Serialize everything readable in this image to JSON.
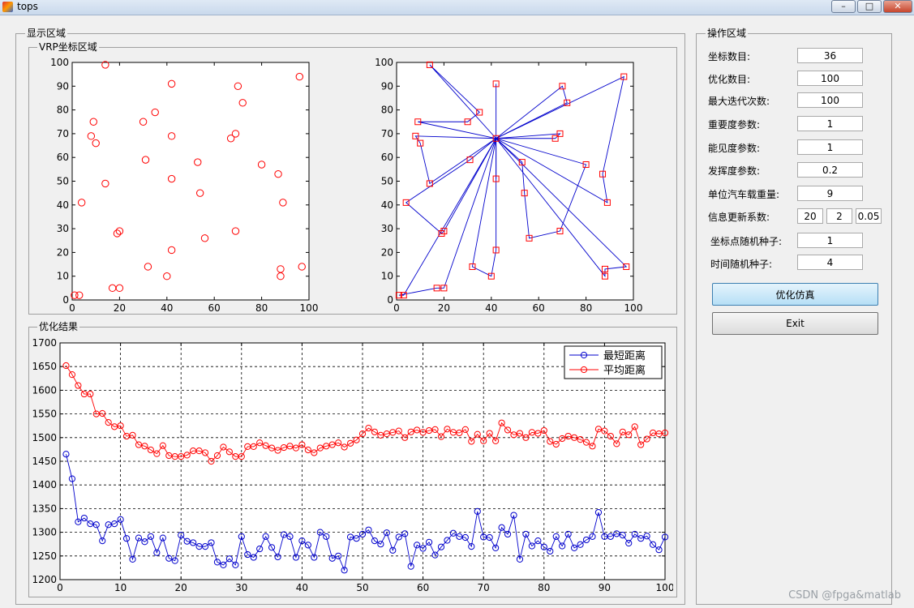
{
  "window": {
    "title": "tops",
    "min_label": "–",
    "max_label": "□",
    "close_label": "✕"
  },
  "display_area": {
    "title": "显示区域",
    "vrp_panel_title": "VRP坐标区域",
    "result_panel_title": "优化结果"
  },
  "operation_area": {
    "title": "操作区域",
    "fields": [
      {
        "label": "坐标数目:",
        "value": "36"
      },
      {
        "label": "优化数目:",
        "value": "100"
      },
      {
        "label": "最大迭代次数:",
        "value": "100"
      },
      {
        "label": "重要度参数:",
        "value": "1"
      },
      {
        "label": "能见度参数:",
        "value": "1"
      },
      {
        "label": "发挥度参数:",
        "value": "0.2"
      },
      {
        "label": "单位汽车载重量:",
        "value": "9"
      }
    ],
    "update_coeff": {
      "label": "信息更新系数:",
      "values": [
        "20",
        "2",
        "0.05"
      ]
    },
    "coord_seed": {
      "label": "坐标点随机种子:",
      "value": "1"
    },
    "time_seed": {
      "label": "时间随机种子:",
      "value": "4"
    },
    "simulate_button": "优化仿真",
    "exit_button": "Exit"
  },
  "watermark": "CSDN @fpga&matlab",
  "colors": {
    "red": "#ff0000",
    "blue": "#0000cc",
    "panel_bg": "#f0f0f0"
  },
  "chart_data": [
    {
      "type": "scatter",
      "title": "",
      "xlim": [
        0,
        100
      ],
      "ylim": [
        0,
        100
      ],
      "xticks": [
        "0",
        "20",
        "40",
        "60",
        "80",
        "100"
      ],
      "yticks": [
        "0",
        "10",
        "20",
        "30",
        "40",
        "50",
        "60",
        "70",
        "80",
        "90",
        "100"
      ],
      "marker": "circle",
      "color": "red",
      "points": [
        [
          1,
          2
        ],
        [
          3,
          2
        ],
        [
          4,
          41
        ],
        [
          8,
          69
        ],
        [
          9,
          75
        ],
        [
          10,
          66
        ],
        [
          14,
          49
        ],
        [
          14,
          99
        ],
        [
          17,
          5
        ],
        [
          19,
          28
        ],
        [
          20,
          5
        ],
        [
          20,
          29
        ],
        [
          30,
          75
        ],
        [
          31,
          59
        ],
        [
          32,
          14
        ],
        [
          35,
          79
        ],
        [
          40,
          10
        ],
        [
          42,
          69
        ],
        [
          42,
          91
        ],
        [
          42,
          51
        ],
        [
          42,
          21
        ],
        [
          53,
          58
        ],
        [
          54,
          45
        ],
        [
          56,
          26
        ],
        [
          67,
          68
        ],
        [
          69,
          29
        ],
        [
          69,
          70
        ],
        [
          70,
          90
        ],
        [
          72,
          83
        ],
        [
          80,
          57
        ],
        [
          87,
          53
        ],
        [
          88,
          10
        ],
        [
          88,
          13
        ],
        [
          89,
          41
        ],
        [
          96,
          94
        ],
        [
          97,
          14
        ]
      ]
    },
    {
      "type": "line",
      "title": "",
      "xlim": [
        0,
        100
      ],
      "ylim": [
        0,
        100
      ],
      "xticks": [
        "0",
        "20",
        "40",
        "60",
        "80",
        "100"
      ],
      "yticks": [
        "0",
        "10",
        "20",
        "30",
        "40",
        "50",
        "60",
        "70",
        "80",
        "90",
        "100"
      ],
      "marker": "square",
      "marker_color": "red",
      "line_color": "blue",
      "depot": [
        42,
        68
      ],
      "routes": [
        [
          [
            42,
            68
          ],
          [
            14,
            99
          ],
          [
            35,
            79
          ],
          [
            30,
            75
          ],
          [
            9,
            75
          ],
          [
            42,
            68
          ]
        ],
        [
          [
            42,
            68
          ],
          [
            8,
            69
          ],
          [
            10,
            66
          ],
          [
            14,
            49
          ],
          [
            42,
            68
          ]
        ],
        [
          [
            42,
            68
          ],
          [
            42,
            91
          ],
          [
            42,
            68
          ]
        ],
        [
          [
            42,
            68
          ],
          [
            70,
            90
          ],
          [
            72,
            83
          ],
          [
            42,
            68
          ]
        ],
        [
          [
            42,
            68
          ],
          [
            67,
            68
          ],
          [
            69,
            70
          ],
          [
            42,
            68
          ]
        ],
        [
          [
            42,
            68
          ],
          [
            96,
            94
          ],
          [
            87,
            53
          ],
          [
            89,
            41
          ],
          [
            42,
            68
          ]
        ],
        [
          [
            42,
            68
          ],
          [
            80,
            57
          ],
          [
            69,
            29
          ],
          [
            56,
            26
          ],
          [
            54,
            45
          ],
          [
            53,
            58
          ],
          [
            42,
            68
          ]
        ],
        [
          [
            42,
            68
          ],
          [
            97,
            14
          ],
          [
            88,
            13
          ],
          [
            88,
            10
          ],
          [
            42,
            68
          ]
        ],
        [
          [
            42,
            68
          ],
          [
            42,
            51
          ],
          [
            42,
            68
          ]
        ],
        [
          [
            42,
            68
          ],
          [
            42,
            21
          ],
          [
            40,
            10
          ],
          [
            32,
            14
          ],
          [
            42,
            68
          ]
        ],
        [
          [
            42,
            68
          ],
          [
            31,
            59
          ],
          [
            4,
            41
          ],
          [
            19,
            28
          ],
          [
            20,
            29
          ],
          [
            42,
            68
          ]
        ],
        [
          [
            42,
            68
          ],
          [
            3,
            2
          ],
          [
            1,
            2
          ],
          [
            17,
            5
          ],
          [
            20,
            5
          ],
          [
            42,
            68
          ]
        ]
      ]
    },
    {
      "type": "line",
      "title": "",
      "xlim": [
        0,
        100
      ],
      "ylim": [
        1200,
        1700
      ],
      "xticks": [
        "0",
        "10",
        "20",
        "30",
        "40",
        "50",
        "60",
        "70",
        "80",
        "90",
        "100"
      ],
      "yticks": [
        "1200",
        "1250",
        "1300",
        "1350",
        "1400",
        "1450",
        "1500",
        "1550",
        "1600",
        "1650",
        "1700"
      ],
      "grid": true,
      "legend_position": "top-right",
      "series": [
        {
          "name": "最短距离",
          "color": "blue",
          "values": [
            1465,
            1413,
            1322,
            1330,
            1318,
            1316,
            1282,
            1316,
            1318,
            1327,
            1287,
            1243,
            1288,
            1280,
            1291,
            1257,
            1288,
            1245,
            1240,
            1294,
            1281,
            1278,
            1270,
            1270,
            1278,
            1237,
            1231,
            1244,
            1231,
            1291,
            1253,
            1247,
            1265,
            1291,
            1268,
            1248,
            1295,
            1291,
            1247,
            1282,
            1273,
            1247,
            1300,
            1291,
            1245,
            1250,
            1220,
            1290,
            1287,
            1296,
            1305,
            1282,
            1275,
            1299,
            1262,
            1290,
            1297,
            1228,
            1273,
            1266,
            1279,
            1252,
            1269,
            1283,
            1298,
            1291,
            1289,
            1270,
            1344,
            1290,
            1289,
            1267,
            1310,
            1296,
            1336,
            1243,
            1296,
            1271,
            1282,
            1269,
            1260,
            1291,
            1271,
            1296,
            1267,
            1274,
            1284,
            1291,
            1342,
            1291,
            1291,
            1297,
            1294,
            1277,
            1296,
            1287,
            1292,
            1274,
            1263,
            1290
          ]
        },
        {
          "name": "平均距离",
          "color": "red",
          "values": [
            1652,
            1633,
            1610,
            1592,
            1592,
            1550,
            1551,
            1532,
            1523,
            1525,
            1503,
            1505,
            1485,
            1482,
            1474,
            1466,
            1483,
            1462,
            1460,
            1460,
            1463,
            1472,
            1472,
            1468,
            1450,
            1462,
            1480,
            1470,
            1460,
            1460,
            1481,
            1481,
            1489,
            1483,
            1478,
            1473,
            1479,
            1482,
            1478,
            1485,
            1474,
            1468,
            1478,
            1482,
            1485,
            1489,
            1480,
            1488,
            1495,
            1508,
            1520,
            1512,
            1505,
            1508,
            1511,
            1514,
            1500,
            1512,
            1516,
            1511,
            1515,
            1517,
            1502,
            1518,
            1511,
            1510,
            1517,
            1492,
            1507,
            1493,
            1509,
            1493,
            1531,
            1516,
            1506,
            1509,
            1500,
            1511,
            1509,
            1515,
            1492,
            1486,
            1498,
            1503,
            1500,
            1496,
            1490,
            1482,
            1518,
            1514,
            1503,
            1487,
            1512,
            1506,
            1523,
            1485,
            1497,
            1510,
            1508,
            1510
          ]
        }
      ]
    }
  ]
}
